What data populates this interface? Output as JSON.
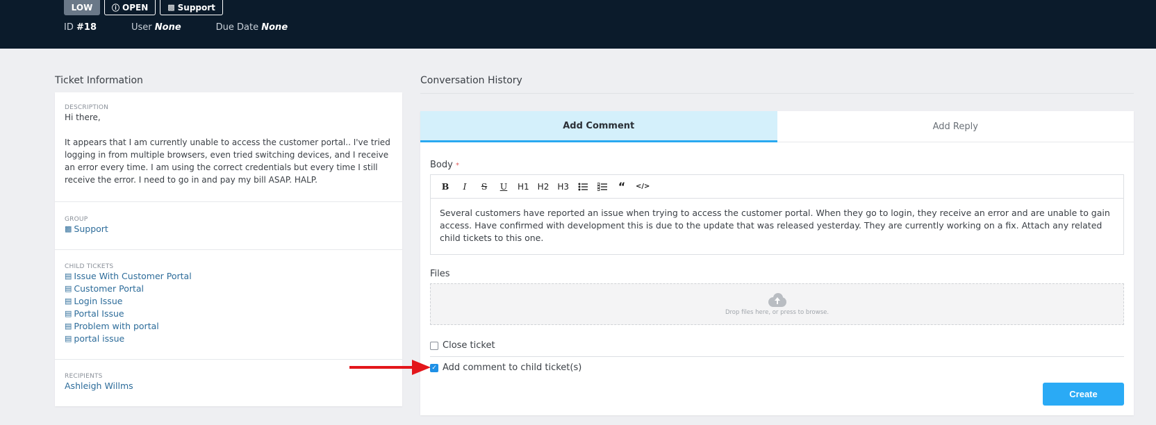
{
  "header": {
    "priority": "LOW",
    "status": "OPEN",
    "status_icon": "info-icon",
    "group": "Support",
    "group_icon": "group-icon",
    "id_label": "ID",
    "id_value": "#18",
    "user_label": "User",
    "user_value": "None",
    "due_label": "Due Date",
    "due_value": "None"
  },
  "ticket_info": {
    "title": "Ticket Information",
    "description_label": "DESCRIPTION",
    "description": "Hi there,\n\nIt appears that I am currently unable to access the customer portal.. I've tried logging in from multiple browsers, even tried switching devices, and I receive an error every time. I am using the correct credentials but every time I still receive the error. I need to go in and pay my bill ASAP. HALP.",
    "group_label": "GROUP",
    "group": "Support",
    "child_tickets_label": "CHILD TICKETS",
    "child_tickets": [
      "Issue With Customer Portal",
      "Customer Portal",
      "Login Issue",
      "Portal Issue",
      "Problem with portal",
      "portal issue"
    ],
    "recipients_label": "RECIPIENTS",
    "recipient": "Ashleigh Willms"
  },
  "conversation": {
    "title": "Conversation History",
    "tabs": [
      "Add Comment",
      "Add Reply"
    ],
    "active_tab": "Add Comment",
    "body_label": "Body",
    "required_mark": "*",
    "toolbar": [
      "B",
      "I",
      "S",
      "U",
      "H1",
      "H2",
      "H3",
      "bulleted-list",
      "numbered-list",
      "quote",
      "code"
    ],
    "body_text": "Several customers have reported an issue when trying to access the customer portal. When they go to login, they receive an error and are unable to gain access. Have confirmed with development this is due to the update that was released yesterday. They are currently working on a fix. Attach any related child tickets to this one.",
    "files_label": "Files",
    "dropzone_text": "Drop files here, or press to browse.",
    "close_ticket_label": "Close ticket",
    "close_ticket_checked": false,
    "add_comment_child_label": "Add comment to child ticket(s)",
    "add_comment_child_checked": true,
    "create_label": "Create"
  },
  "colors": {
    "header_bg": "#0b1b2b",
    "accent": "#2aaaf5",
    "tab_active_bg": "#d4f0fb",
    "link": "#2d6c9a",
    "annotation_arrow": "#e3161b"
  }
}
